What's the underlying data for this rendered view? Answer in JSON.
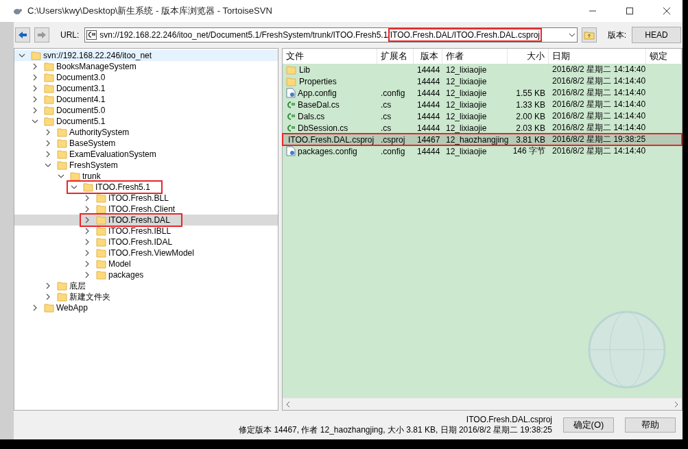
{
  "window": {
    "title": "C:\\Users\\kwy\\Desktop\\新生系统 - 版本库浏览器 - TortoiseSVN"
  },
  "toolbar": {
    "url_label": "URL:",
    "url": {
      "value": "svn://192.168.22.246/itoo_net/Document5.1/FreshSystem/trunk/ITOO.Fresh5.1/",
      "marked_part": "ITOO.Fresh.DAL/ITOO.Fresh.DAL.csproj"
    },
    "revision_label": "版本:",
    "revision_button": "HEAD"
  },
  "tree": [
    {
      "label": "svn://192.168.22.246/itoo_net",
      "expanded": true,
      "selected": false,
      "marked": false,
      "children": [
        {
          "label": "BooksManageSystem",
          "expanded": false,
          "selected": false,
          "marked": false
        },
        {
          "label": "Document3.0",
          "expanded": false,
          "selected": false,
          "marked": false
        },
        {
          "label": "Document3.1",
          "expanded": false,
          "selected": false,
          "marked": false
        },
        {
          "label": "Document4.1",
          "expanded": false,
          "selected": false,
          "marked": false
        },
        {
          "label": "Document5.0",
          "expanded": false,
          "selected": false,
          "marked": false
        },
        {
          "label": "Document5.1",
          "expanded": true,
          "selected": false,
          "marked": false,
          "children": [
            {
              "label": "AuthoritySystem",
              "expanded": false,
              "selected": false,
              "marked": false
            },
            {
              "label": "BaseSystem",
              "expanded": false,
              "selected": false,
              "marked": false
            },
            {
              "label": "ExamEvaluationSystem",
              "expanded": false,
              "selected": false,
              "marked": false
            },
            {
              "label": "FreshSystem",
              "expanded": true,
              "selected": false,
              "marked": false,
              "children": [
                {
                  "label": "trunk",
                  "expanded": true,
                  "selected": false,
                  "marked": false,
                  "children": [
                    {
                      "label": "ITOO.Fresh5.1",
                      "expanded": true,
                      "selected": false,
                      "marked": true,
                      "children": [
                        {
                          "label": "ITOO.Fresh.BLL",
                          "expanded": false,
                          "selected": false,
                          "marked": false
                        },
                        {
                          "label": "ITOO.Fresh.Client",
                          "expanded": false,
                          "selected": false,
                          "marked": false
                        },
                        {
                          "label": "ITOO.Fresh.DAL",
                          "expanded": false,
                          "selected": true,
                          "marked": true
                        },
                        {
                          "label": "ITOO.Fresh.IBLL",
                          "expanded": false,
                          "selected": false,
                          "marked": false
                        },
                        {
                          "label": "ITOO.Fresh.IDAL",
                          "expanded": false,
                          "selected": false,
                          "marked": false
                        },
                        {
                          "label": "ITOO.Fresh.ViewModel",
                          "expanded": false,
                          "selected": false,
                          "marked": false
                        },
                        {
                          "label": "Model",
                          "expanded": false,
                          "selected": false,
                          "marked": false
                        },
                        {
                          "label": "packages",
                          "expanded": false,
                          "selected": false,
                          "marked": false
                        }
                      ]
                    }
                  ]
                }
              ]
            },
            {
              "label": "底层",
              "expanded": false,
              "selected": false,
              "marked": false
            },
            {
              "label": "新建文件夹",
              "expanded": false,
              "selected": false,
              "marked": false
            }
          ]
        },
        {
          "label": "WebApp",
          "expanded": false,
          "selected": false,
          "marked": false
        }
      ]
    }
  ],
  "table": {
    "columns": [
      "文件",
      "扩展名",
      "版本",
      "作者",
      "大小",
      "日期",
      "锁定"
    ],
    "rows": [
      {
        "kind": "folder",
        "name": "Lib",
        "ext": "",
        "rev": "14444",
        "author": "12_lixiaojie",
        "size": "",
        "date": "2016/8/2 星期二 14:14:40",
        "selected": false
      },
      {
        "kind": "folder",
        "name": "Properties",
        "ext": "",
        "rev": "14444",
        "author": "12_lixiaojie",
        "size": "",
        "date": "2016/8/2 星期二 14:14:40",
        "selected": false
      },
      {
        "kind": "config",
        "name": "App.config",
        "ext": ".config",
        "rev": "14444",
        "author": "12_lixiaojie",
        "size": "1.55 KB",
        "date": "2016/8/2 星期二 14:14:40",
        "selected": false
      },
      {
        "kind": "cs",
        "name": "BaseDal.cs",
        "ext": ".cs",
        "rev": "14444",
        "author": "12_lixiaojie",
        "size": "1.33 KB",
        "date": "2016/8/2 星期二 14:14:40",
        "selected": false
      },
      {
        "kind": "cs",
        "name": "Dals.cs",
        "ext": ".cs",
        "rev": "14444",
        "author": "12_lixiaojie",
        "size": "2.00 KB",
        "date": "2016/8/2 星期二 14:14:40",
        "selected": false
      },
      {
        "kind": "cs",
        "name": "DbSession.cs",
        "ext": ".cs",
        "rev": "14444",
        "author": "12_lixiaojie",
        "size": "2.03 KB",
        "date": "2016/8/2 星期二 14:14:40",
        "selected": false
      },
      {
        "kind": "csproj",
        "name": "ITOO.Fresh.DAL.csproj",
        "ext": ".csproj",
        "rev": "14467",
        "author": "12_haozhangjing",
        "size": "3.81 KB",
        "date": "2016/8/2 星期二 19:38:25",
        "selected": true
      },
      {
        "kind": "config",
        "name": "packages.config",
        "ext": ".config",
        "rev": "14444",
        "author": "12_lixiaojie",
        "size": "146 字节",
        "date": "2016/8/2 星期二 14:14:40",
        "selected": false
      }
    ]
  },
  "status": {
    "file": "ITOO.Fresh.DAL.csproj",
    "details": "修定版本 14467, 作者 12_haozhangjing, 大小 3.81 KB, 日期 2016/8/2 星期二 19:38:25"
  },
  "buttons": [
    "确定(O)",
    "帮助"
  ]
}
